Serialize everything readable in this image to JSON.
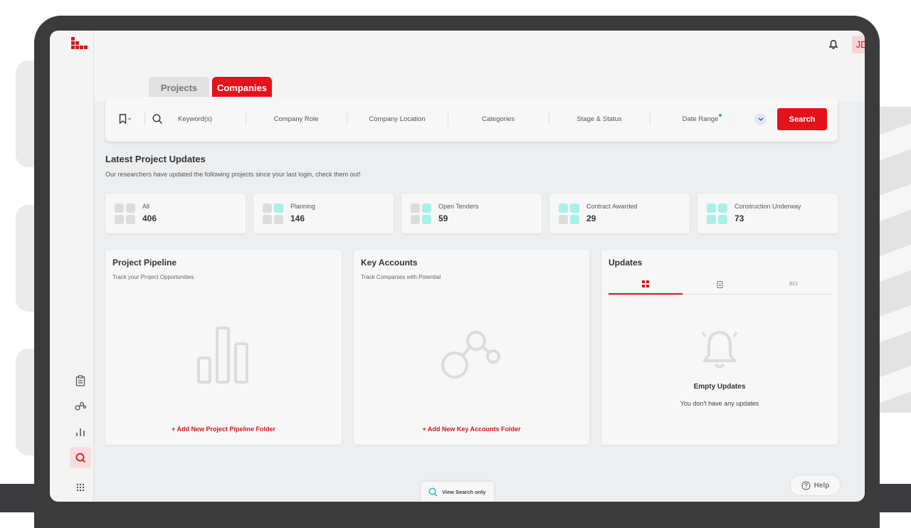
{
  "header": {
    "avatar_initials": "JD"
  },
  "tabs": {
    "projects": "Projects",
    "companies": "Companies"
  },
  "search": {
    "keyword": "Keyword(s)",
    "company_role": "Company Role",
    "company_location": "Company Location",
    "categories": "Categories",
    "stage_status": "Stage & Status",
    "date_range": "Date Range",
    "button": "Search"
  },
  "updates_summary": {
    "title": "Latest Project Updates",
    "subtitle": "Our researchers have updated the following projects since your last login, check them out!",
    "cards": [
      {
        "label": "All",
        "value": "406"
      },
      {
        "label": "Planning",
        "value": "146"
      },
      {
        "label": "Open Tenders",
        "value": "59"
      },
      {
        "label": "Contract Awarded",
        "value": "29"
      },
      {
        "label": "Construction Underway",
        "value": "73"
      }
    ]
  },
  "pipeline": {
    "title": "Project Pipeline",
    "subtitle": "Track your Project Opportunities",
    "add_label": "Add New Project Pipeline Folder"
  },
  "key_accounts": {
    "title": "Key Accounts",
    "subtitle": "Track Companies with Potential",
    "add_label": "Add New Key Accounts Folder"
  },
  "updates_panel": {
    "title": "Updates",
    "tab_bci": "BCI",
    "empty_title": "Empty Updates",
    "empty_sub": "You don't have any updates"
  },
  "footer": {
    "view_search": "View Search only",
    "help": "Help"
  },
  "colors": {
    "brand_red": "#e3121b",
    "accent_teal": "#a8f0e8",
    "status_green": "#2bb673"
  }
}
